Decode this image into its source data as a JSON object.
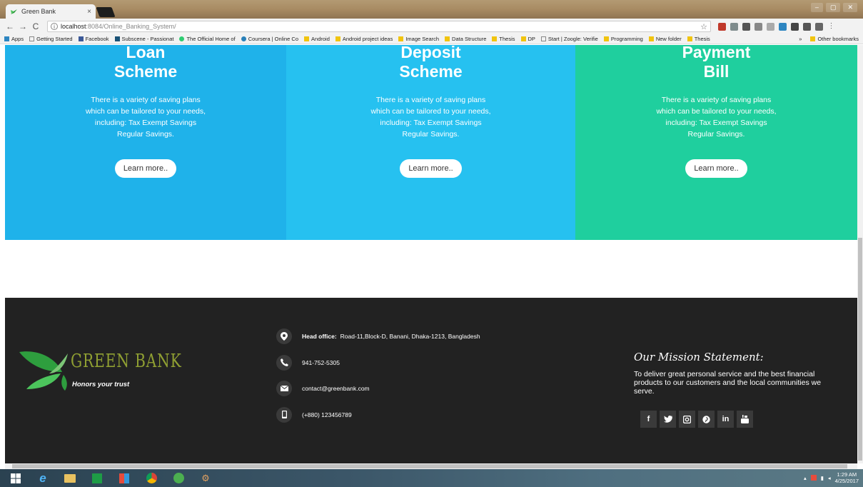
{
  "browser": {
    "tab_title": "Green Bank",
    "tab_close": "×",
    "url_host": "localhost",
    "url_path": ":8084/Online_Banking_System/",
    "bookmarks": [
      "Apps",
      "Getting Started",
      "Facebook",
      "Subscene - Passionat",
      "The Official Home of",
      "Coursera | Online Co",
      "Android",
      "Android project ideas",
      "Image Search",
      "Data Structure",
      "Thesis",
      "DP",
      "Start | Zoogle: Verifie",
      "Programming",
      "New folder",
      "Thesis"
    ],
    "bookmarks_overflow": "»",
    "other_bookmarks": "Other bookmarks"
  },
  "schemes": [
    {
      "line1": "Loan",
      "line2": "Scheme",
      "description": "There is a variety of saving plans which can be tailored to your needs, including: Tax Exempt Savings Regular Savings.",
      "button": "Learn more..",
      "color": "#1fb2ea"
    },
    {
      "line1": "Deposit",
      "line2": "Scheme",
      "description": "There is a variety of saving plans which can be tailored to your needs, including: Tax Exempt Savings Regular Savings.",
      "button": "Learn more..",
      "color": "#26c1f0"
    },
    {
      "line1": "Payment",
      "line2": "Bill",
      "description": "There is a variety of saving plans which can be tailored to your needs, including: Tax Exempt Savings Regular Savings.",
      "button": "Learn more..",
      "color": "#1fcf9e"
    }
  ],
  "footer": {
    "logo_text": "GREEN BANK",
    "tagline": "Honors your trust",
    "contact": {
      "head_office_label": "Head office:",
      "head_office_value": "Road-11,Block-D, Banani, Dhaka-1213, Bangladesh",
      "phone": "941-752-5305",
      "email": "contact@greenbank.com",
      "mobile": "(+880) 123456789"
    },
    "mission_title": "Our Mission Statement:",
    "mission_text": "To deliver great personal service and the best financial products to our customers and the local communities we serve.",
    "social": [
      "f",
      "t",
      "ig",
      "p",
      "in",
      "yt"
    ]
  },
  "taskbar": {
    "time": "1:29 AM",
    "date": "4/25/2017"
  },
  "colors": {
    "footer_bg": "#222222",
    "logo_green": "#8f9f32"
  }
}
